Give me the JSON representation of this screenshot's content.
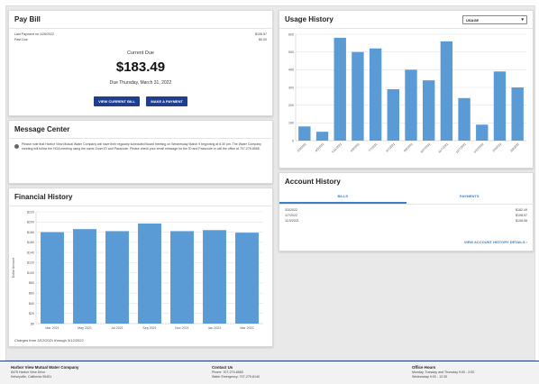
{
  "pay_bill": {
    "title": "Pay Bill",
    "last_payment_label": "Last Payment on 1/26/2022",
    "last_payment_value": "$108.57",
    "past_due_label": "Past Due",
    "past_due_value": "$0.00",
    "current_due_label": "Current Due",
    "amount": "$183.49",
    "due_text": "Due Thursday, March 31, 2022",
    "view_bill_label": "VIEW CURRENT BILL",
    "make_payment_label": "MAKE A PAYMENT"
  },
  "message_center": {
    "title": "Message Center",
    "message": "Please note that Harbor View Mutual Water Company will have their regularly scheduled Board meeting on Wednesday March 9 beginning at 6:30 pm. The Water Company meeting will follow the HOA meeting using the same Zoom ID and Passcode. Please check your email message for the ID and Passcode or call the office at 707-279-8565."
  },
  "financial_history": {
    "title": "Financial History",
    "footnote": "Charges from 3/12/2021 through 3/12/2022",
    "chart_data": {
      "type": "bar",
      "categories": [
        "Mar 2021",
        "May 2021",
        "Jul 2021",
        "Sep 2021",
        "Nov 2021",
        "Jan 2022",
        "Mar 2022"
      ],
      "values": [
        180,
        186,
        182,
        197,
        182,
        184,
        179
      ],
      "ylabel": "Dollar Amount",
      "yticks": [
        "$0",
        "$20",
        "$40",
        "$60",
        "$80",
        "$100",
        "$120",
        "$140",
        "$160",
        "$180",
        "$200",
        "$220"
      ],
      "ylim": [
        0,
        220
      ],
      "grid": true,
      "color": "#5b9bd5"
    }
  },
  "usage_history": {
    "title": "Usage History",
    "select_value": "USAGE",
    "chart_data": {
      "type": "bar",
      "categories": [
        "3/9/2021",
        "4/9/2021",
        "5/11/2021",
        "6/8/2021",
        "7/7/2021",
        "8/7/2021",
        "9/8/2021",
        "10/7/2021",
        "11/7/2021",
        "12/7/2021",
        "1/12/2022",
        "2/9/2022",
        "3/9/2022"
      ],
      "values": [
        80,
        50,
        580,
        500,
        520,
        290,
        400,
        340,
        560,
        240,
        90,
        390,
        300
      ],
      "yticks": [
        "0",
        "100",
        "200",
        "300",
        "400",
        "500",
        "600"
      ],
      "ylim": [
        0,
        600
      ],
      "grid": true,
      "color": "#5b9bd5"
    }
  },
  "account_history": {
    "title": "Account History",
    "tabs": [
      "BILLS",
      "PAYMENTS"
    ],
    "rows": [
      {
        "date": "3/3/2022",
        "amount": "$182.49"
      },
      {
        "date": "1/7/2022",
        "amount": "$108.57"
      },
      {
        "date": "11/3/2021",
        "amount": "$108.58"
      }
    ],
    "details_link": "VIEW ACCOUNT HISTORY DETAILS"
  },
  "footer": {
    "company": "Harbor View Mutual Water Company",
    "address1": "8475 Harbor View Drive",
    "address2": "Kelseyville, California 95451",
    "contact_heading": "Contact Us",
    "phone": "Phone: 707-279-8565",
    "emergency": "Water Emergency: 707-279-6140",
    "hours_heading": "Office Hours",
    "hours1": "Monday, Tuesday and Thursday 9:00 - 2:00",
    "hours2": "Wednesday 9:00 - 12:30"
  }
}
